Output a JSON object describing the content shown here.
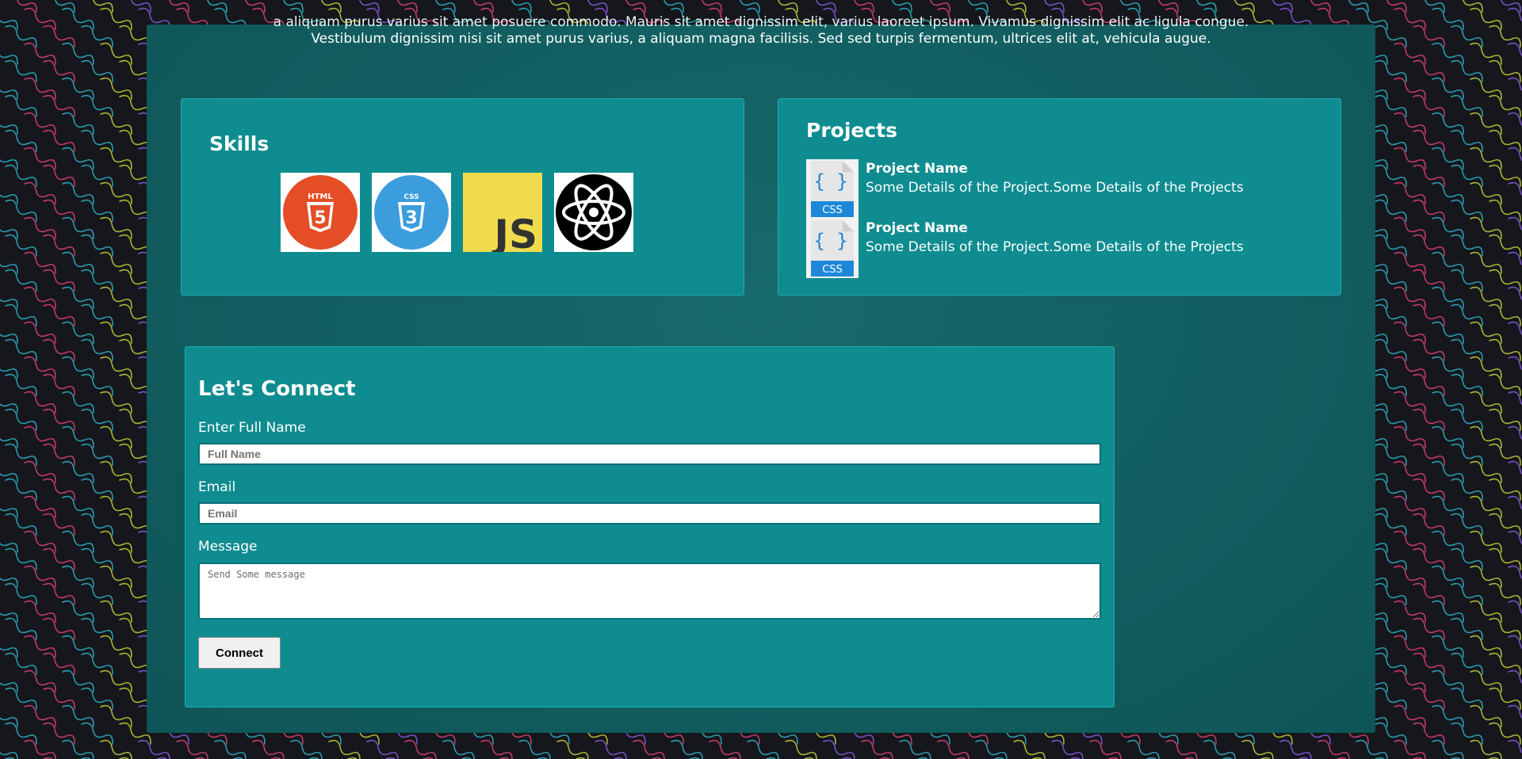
{
  "intro": {
    "cut_line": "a aliquam purus varius sit amet posuere commodo. Mauris sit amet dignissim elit, varius laoreet ipsum. Vivamus dignissim elit ac ligula congue.",
    "line": "Vestibulum dignissim nisi sit amet purus varius, a aliquam magna facilisis. Sed sed turpis fermentum, ultrices elit at, vehicula augue."
  },
  "skills": {
    "title": "Skills",
    "icons": [
      {
        "name": "html5-icon",
        "text": "HTML",
        "color": "#e44d26"
      },
      {
        "name": "css3-icon",
        "text": "CSS",
        "color": "#3c9ddd"
      },
      {
        "name": "javascript-icon",
        "text": "JS",
        "color": "#f0db4f"
      },
      {
        "name": "react-icon",
        "text": "",
        "color": "#000000"
      }
    ]
  },
  "projects": {
    "title": "Projects",
    "items": [
      {
        "name": "Project Name",
        "details": "Some Details of the Project.Some Details of the Projects",
        "thumb_icon": "css-file-icon",
        "thumb_label": "CSS"
      },
      {
        "name": "Project Name",
        "details": "Some Details of the Project.Some Details of the Projects",
        "thumb_icon": "css-file-icon",
        "thumb_label": "CSS"
      }
    ]
  },
  "connect": {
    "title": "Let's Connect",
    "name_label": "Enter Full Name",
    "name_placeholder": "Full Name",
    "email_label": "Email",
    "email_placeholder": "Email",
    "message_label": "Message",
    "message_placeholder": "Send Some message",
    "button_label": "Connect"
  },
  "colors": {
    "page_bg": "#15171c",
    "panel": "#125e60",
    "card": "#0e8c90",
    "card_border": "#22aab0"
  }
}
